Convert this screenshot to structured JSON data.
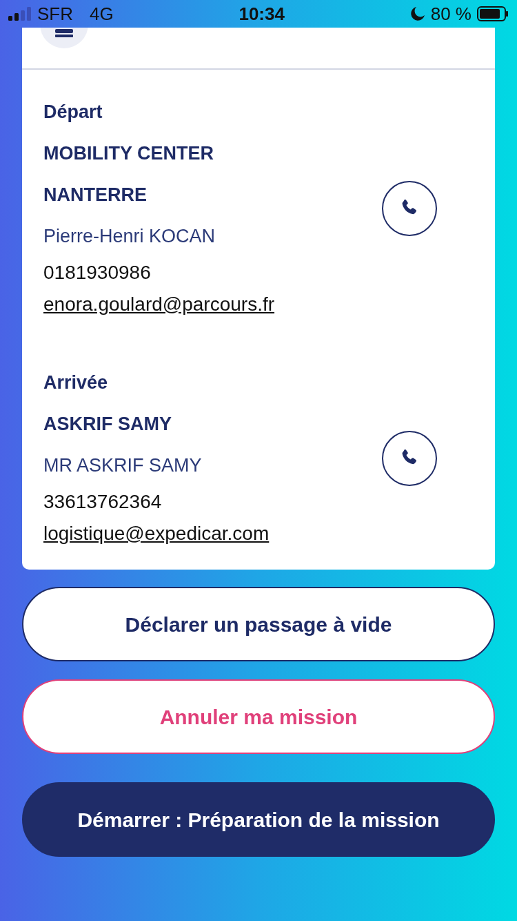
{
  "status_bar": {
    "carrier": "SFR",
    "network": "4G",
    "time": "10:34",
    "battery": "80 %"
  },
  "contacts": [
    {
      "label": "Départ",
      "company_lines": [
        "MOBILITY CENTER",
        "NANTERRE"
      ],
      "person": "Pierre-Henri KOCAN",
      "phone": "0181930986",
      "email": "enora.goulard@parcours.fr"
    },
    {
      "label": "Arrivée",
      "company_lines": [
        "ASKRIF SAMY"
      ],
      "person": "MR ASKRIF SAMY",
      "phone": "33613762364",
      "email": "logistique@expedicar.com"
    }
  ],
  "buttons": [
    {
      "label": "Déclarer un passage à vide",
      "kind": "outline"
    },
    {
      "label": "Annuler ma mission",
      "kind": "danger"
    },
    {
      "label": "Démarrer : Préparation de la mission",
      "kind": "primary"
    }
  ]
}
